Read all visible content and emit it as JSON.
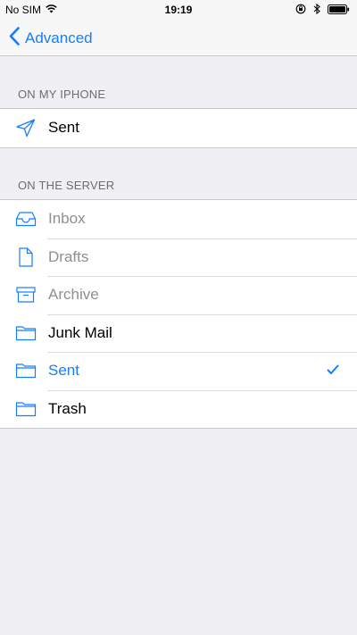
{
  "status_bar": {
    "carrier": "No SIM",
    "time": "19:19"
  },
  "nav": {
    "back_label": "Advanced"
  },
  "sections": {
    "local_header": "ON MY IPHONE",
    "server_header": "ON THE SERVER"
  },
  "local_items": [
    {
      "label": "Sent",
      "icon": "paper-plane-icon"
    }
  ],
  "server_items": [
    {
      "label": "Inbox",
      "icon": "inbox-tray-icon",
      "state": "disabled"
    },
    {
      "label": "Drafts",
      "icon": "document-icon",
      "state": "disabled"
    },
    {
      "label": "Archive",
      "icon": "archive-box-icon",
      "state": "disabled"
    },
    {
      "label": "Junk Mail",
      "icon": "folder-icon",
      "state": "normal"
    },
    {
      "label": "Sent",
      "icon": "folder-icon",
      "state": "selected"
    },
    {
      "label": "Trash",
      "icon": "folder-icon",
      "state": "normal"
    }
  ],
  "colors": {
    "accent": "#157efb",
    "background": "#efeff4",
    "disabled_text": "#8e8e93",
    "section_header": "#6d6d72"
  }
}
